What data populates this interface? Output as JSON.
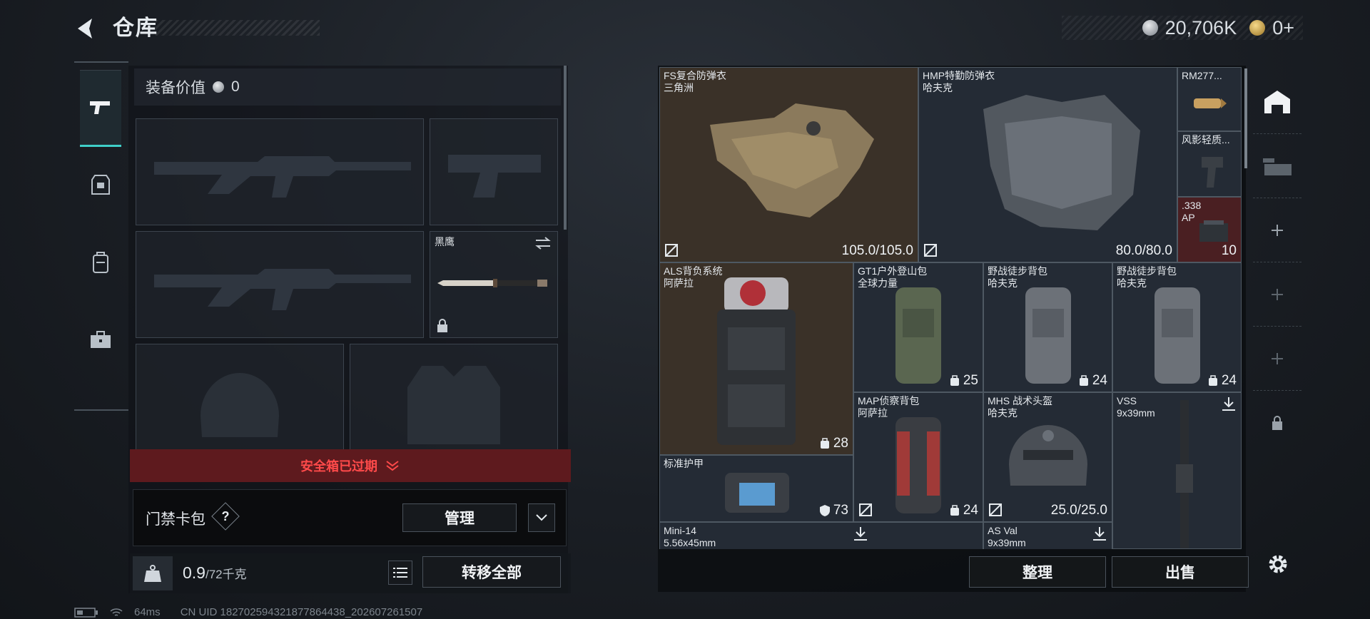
{
  "header": {
    "title": "仓库",
    "currency_silver": "20,706K",
    "currency_gold": "0+"
  },
  "left_tabs": [
    {
      "name": "weapons",
      "icon": "pistol-icon",
      "active": true
    },
    {
      "name": "armor",
      "icon": "armor-icon",
      "active": false
    },
    {
      "name": "backpack",
      "icon": "backpack-icon",
      "active": false
    },
    {
      "name": "case",
      "icon": "toolbox-icon",
      "active": false
    }
  ],
  "equipment": {
    "value_label": "装备价值",
    "value": "0",
    "melee_slot_name": "黑鹰",
    "safebox_banner": "安全箱已过期",
    "keycard_label": "门禁卡包",
    "keycard_help": "?",
    "manage_label": "管理",
    "weight_current": "0.9",
    "weight_max": "/72千克",
    "transfer_all_label": "转移全部"
  },
  "status_bar": {
    "ping": "64ms",
    "uid": "CN UID 1827025943218778644​38_202607261507"
  },
  "storage": {
    "items": [
      {
        "name": "FS复合防弹衣",
        "sub": "三角洲",
        "value": "105.0/105.0"
      },
      {
        "name": "HMP特勤防弹衣",
        "sub": "哈夫克",
        "value": "80.0/80.0"
      },
      {
        "name": "RM277...",
        "sub": "",
        "value": ""
      },
      {
        "name": "风影轻质...",
        "sub": "",
        "value": ""
      },
      {
        "name": ".338",
        "sub": "AP",
        "value": "10"
      },
      {
        "name": "ALS背负系统",
        "sub": "阿萨拉",
        "value": "28"
      },
      {
        "name": "GT1户外登山包",
        "sub": "全球力量",
        "value": "25"
      },
      {
        "name": "野战徒步背包",
        "sub": "哈夫克",
        "value": "24"
      },
      {
        "name": "野战徒步背包",
        "sub": "哈夫克",
        "value": "24"
      },
      {
        "name": "MAP侦察背包",
        "sub": "阿萨拉",
        "value": "24"
      },
      {
        "name": "MHS 战术头盔",
        "sub": "哈夫克",
        "value": "25.0/25.0"
      },
      {
        "name": "VSS",
        "sub": "9x39mm",
        "value": ""
      },
      {
        "name": "标准护甲",
        "sub": "",
        "value": "73"
      },
      {
        "name": "Mini-14",
        "sub": "5.56x45mm",
        "value": ""
      },
      {
        "name": "AS Val",
        "sub": "9x39mm",
        "value": ""
      }
    ],
    "sort_label": "整理",
    "sell_label": "出售"
  },
  "colors": {
    "accent": "#3fd0c9",
    "banner_red": "#ff4a4a",
    "banner_bg": "#5e1a1e"
  }
}
